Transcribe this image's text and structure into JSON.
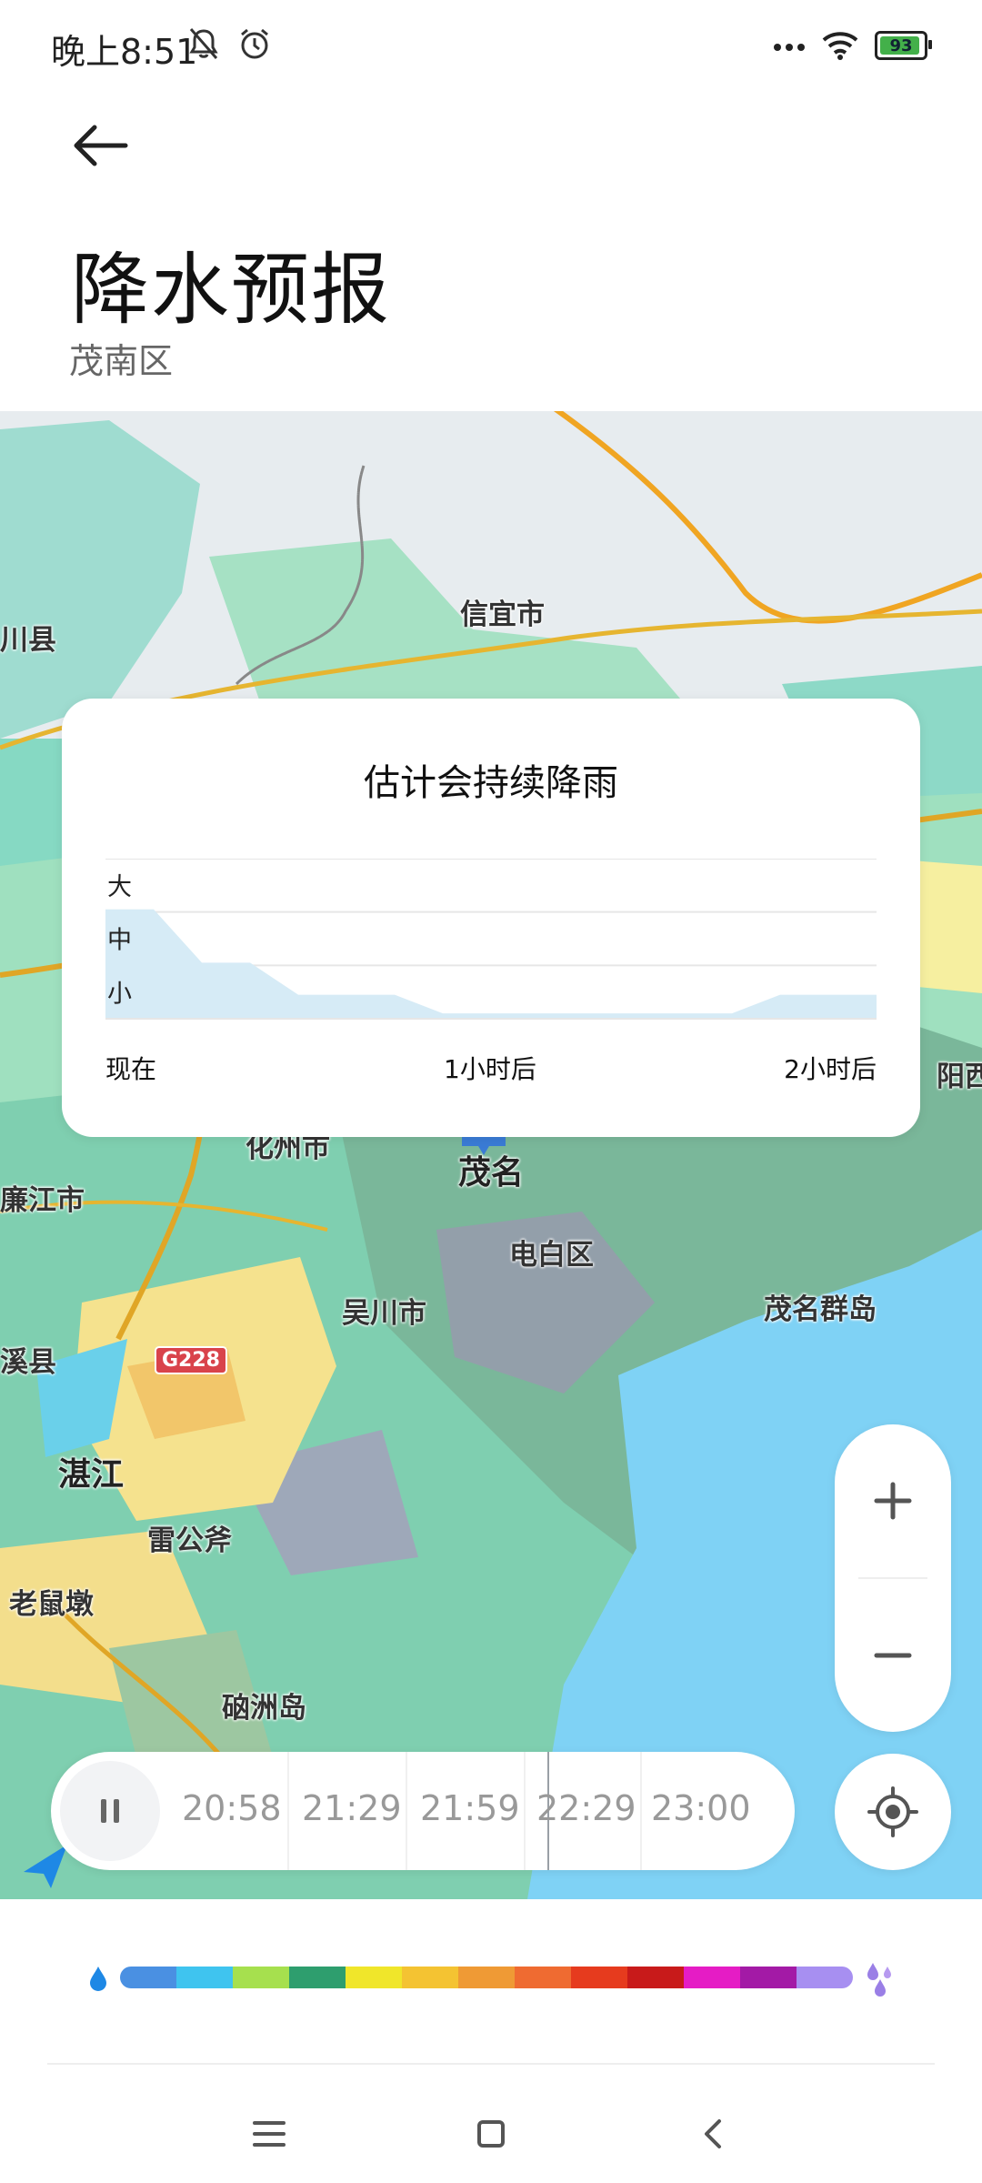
{
  "status_bar": {
    "time": "晚上8:51",
    "battery_level": "93",
    "icons": [
      "bell-muted-icon",
      "alarm-icon",
      "more-dots-icon",
      "wifi-icon",
      "battery-icon"
    ]
  },
  "header": {
    "back_icon": "arrow-left-icon",
    "title": "降水预报",
    "subtitle": "茂南区"
  },
  "forecast_card": {
    "title": "估计会持续降雨",
    "levels": [
      "大",
      "中",
      "小"
    ],
    "x_labels": [
      "现在",
      "1小时后",
      "2小时后"
    ]
  },
  "chart_data": {
    "type": "area",
    "title": "估计会持续降雨",
    "y_categories": [
      "小",
      "中",
      "大"
    ],
    "ylim": [
      0,
      3
    ],
    "x_labels": [
      "现在",
      "1小时后",
      "2小时后"
    ],
    "x": [
      0,
      0.125,
      0.25,
      0.375,
      0.5,
      0.625,
      0.75,
      0.875,
      1.0,
      1.125,
      1.25,
      1.375,
      1.5,
      1.625,
      1.75,
      1.875,
      2.0
    ],
    "values": [
      2.05,
      2.05,
      1.05,
      1.05,
      0.45,
      0.45,
      0.45,
      0.1,
      0.1,
      0.1,
      0.1,
      0.1,
      0.1,
      0.1,
      0.45,
      0.45,
      0.45
    ],
    "color": "#d6ebf6",
    "grid": true
  },
  "map": {
    "labels": [
      "信宜市",
      "化州市",
      "茂名",
      "电白区",
      "吴川市",
      "茂名群岛",
      "湛江",
      "雷公斧",
      "老鼠墩",
      "硇洲岛",
      "廉江市",
      "溪县",
      "川县",
      "阳西"
    ],
    "road_badge": "G228",
    "location_marker_icon": "location-pin-icon"
  },
  "controls": {
    "zoom_in_icon": "plus-icon",
    "zoom_out_icon": "minus-icon",
    "locate_icon": "locate-target-icon",
    "pause_icon": "pause-icon"
  },
  "timeline": {
    "times": [
      "20:58",
      "21:29",
      "21:59",
      "22:29",
      "23:00"
    ]
  },
  "legend": {
    "colors": [
      "#4a90e2",
      "#3fc4ef",
      "#a6e04e",
      "#2e9e6e",
      "#f0e62a",
      "#f4c332",
      "#ef9a35",
      "#ef6b31",
      "#e63b1e",
      "#c81a1a",
      "#e51cc5",
      "#a31aa6",
      "#a78ff1"
    ],
    "left_icon": "water-drop-icon",
    "right_icon": "rain-drops-icon"
  },
  "navbar": {
    "items": [
      "menu-icon",
      "home-icon",
      "back-icon"
    ]
  }
}
